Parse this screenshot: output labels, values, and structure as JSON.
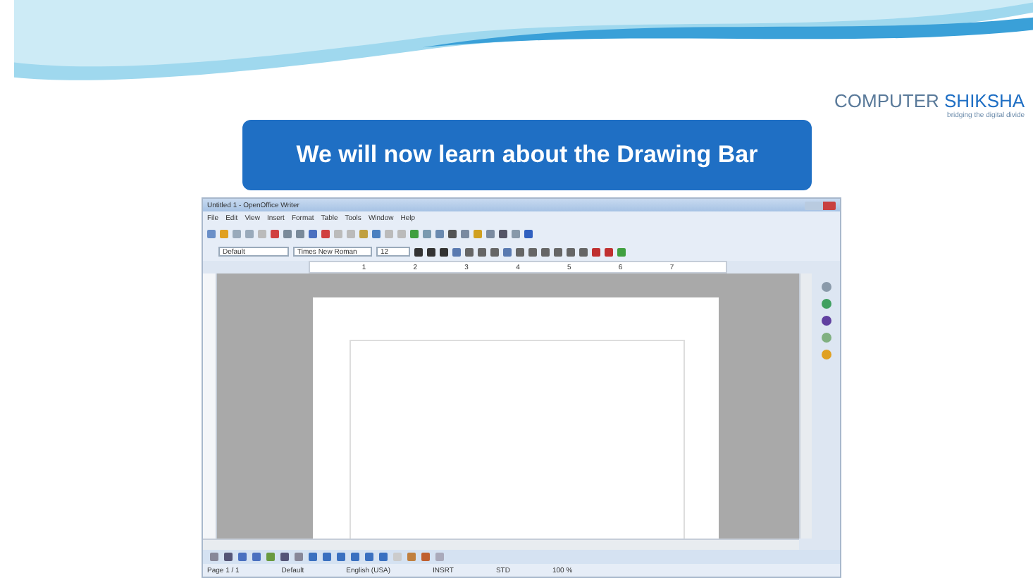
{
  "slide": {
    "title": "We will now learn about the Drawing Bar",
    "logo_first": "COMPUTER",
    "logo_second": "SHIKSHA",
    "tagline": "bridging the digital divide"
  },
  "window": {
    "title": "Untitled 1 - OpenOffice Writer"
  },
  "menu": [
    "File",
    "Edit",
    "View",
    "Insert",
    "Format",
    "Table",
    "Tools",
    "Window",
    "Help"
  ],
  "formatting": {
    "style": "Default",
    "font": "Times New Roman",
    "size": "12"
  },
  "ruler_numbers": [
    "1",
    "2",
    "3",
    "4",
    "5",
    "6",
    "7"
  ],
  "status_bar": [
    "Page 1 / 1",
    "Default",
    "English (USA)",
    "INSRT",
    "STD",
    "100 %"
  ]
}
